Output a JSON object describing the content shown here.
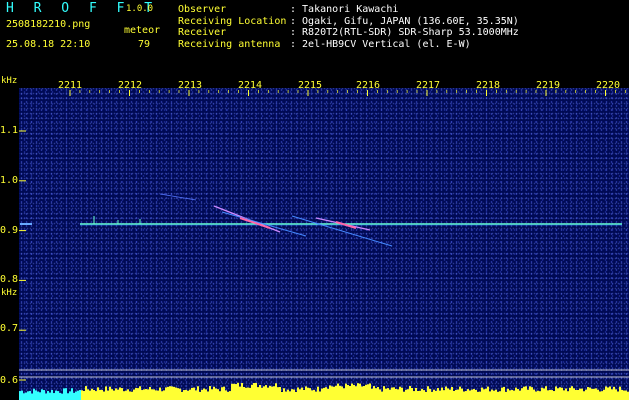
{
  "header": {
    "app_title": "H R O F F T",
    "version": "1.0.0",
    "filename": "2508182210.png",
    "datetime": "25.08.18 22:10",
    "meteor_label": "meteor",
    "meteor_count": "79",
    "info": [
      {
        "key": "Observer",
        "value": ": Takanori Kawachi"
      },
      {
        "key": "Receiving Location",
        "value": ": Ogaki, Gifu, JAPAN (136.60E, 35.35N)"
      },
      {
        "key": "Receiver",
        "value": ": R820T2(RTL-SDR) SDR-Sharp 53.1000MHz"
      },
      {
        "key": "Receiving antenna",
        "value": ": 2el-HB9CV Vertical (el. E-W)"
      }
    ]
  },
  "axes": {
    "unit": "kHz",
    "time_ticks": [
      "2211",
      "2212",
      "2213",
      "2214",
      "2215",
      "2216",
      "2217",
      "2218",
      "2219",
      "2220"
    ],
    "freq_ticks": [
      "1.1",
      "1.0",
      "0.9",
      "0.8",
      "0.7",
      "0.6"
    ]
  },
  "colors": {
    "background": "#000a55",
    "label_yellow": "#ffff33",
    "label_cyan": "#33ffff",
    "carrier": "#66ffcc"
  }
}
